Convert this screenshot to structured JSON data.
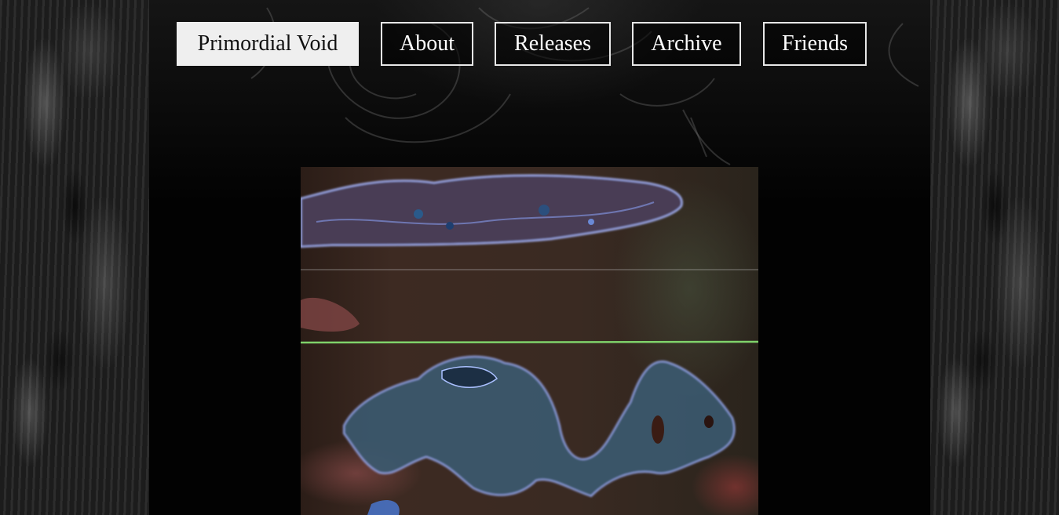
{
  "nav": {
    "items": [
      {
        "label": "Primordial Void",
        "active": true
      },
      {
        "label": "About",
        "active": false
      },
      {
        "label": "Releases",
        "active": false
      },
      {
        "label": "Archive",
        "active": false
      },
      {
        "label": "Friends",
        "active": false
      }
    ]
  },
  "colors": {
    "background": "#050505",
    "nav_border": "#e8e8e8",
    "nav_active_bg": "#efefef",
    "hero_line": "#7fd26a"
  }
}
